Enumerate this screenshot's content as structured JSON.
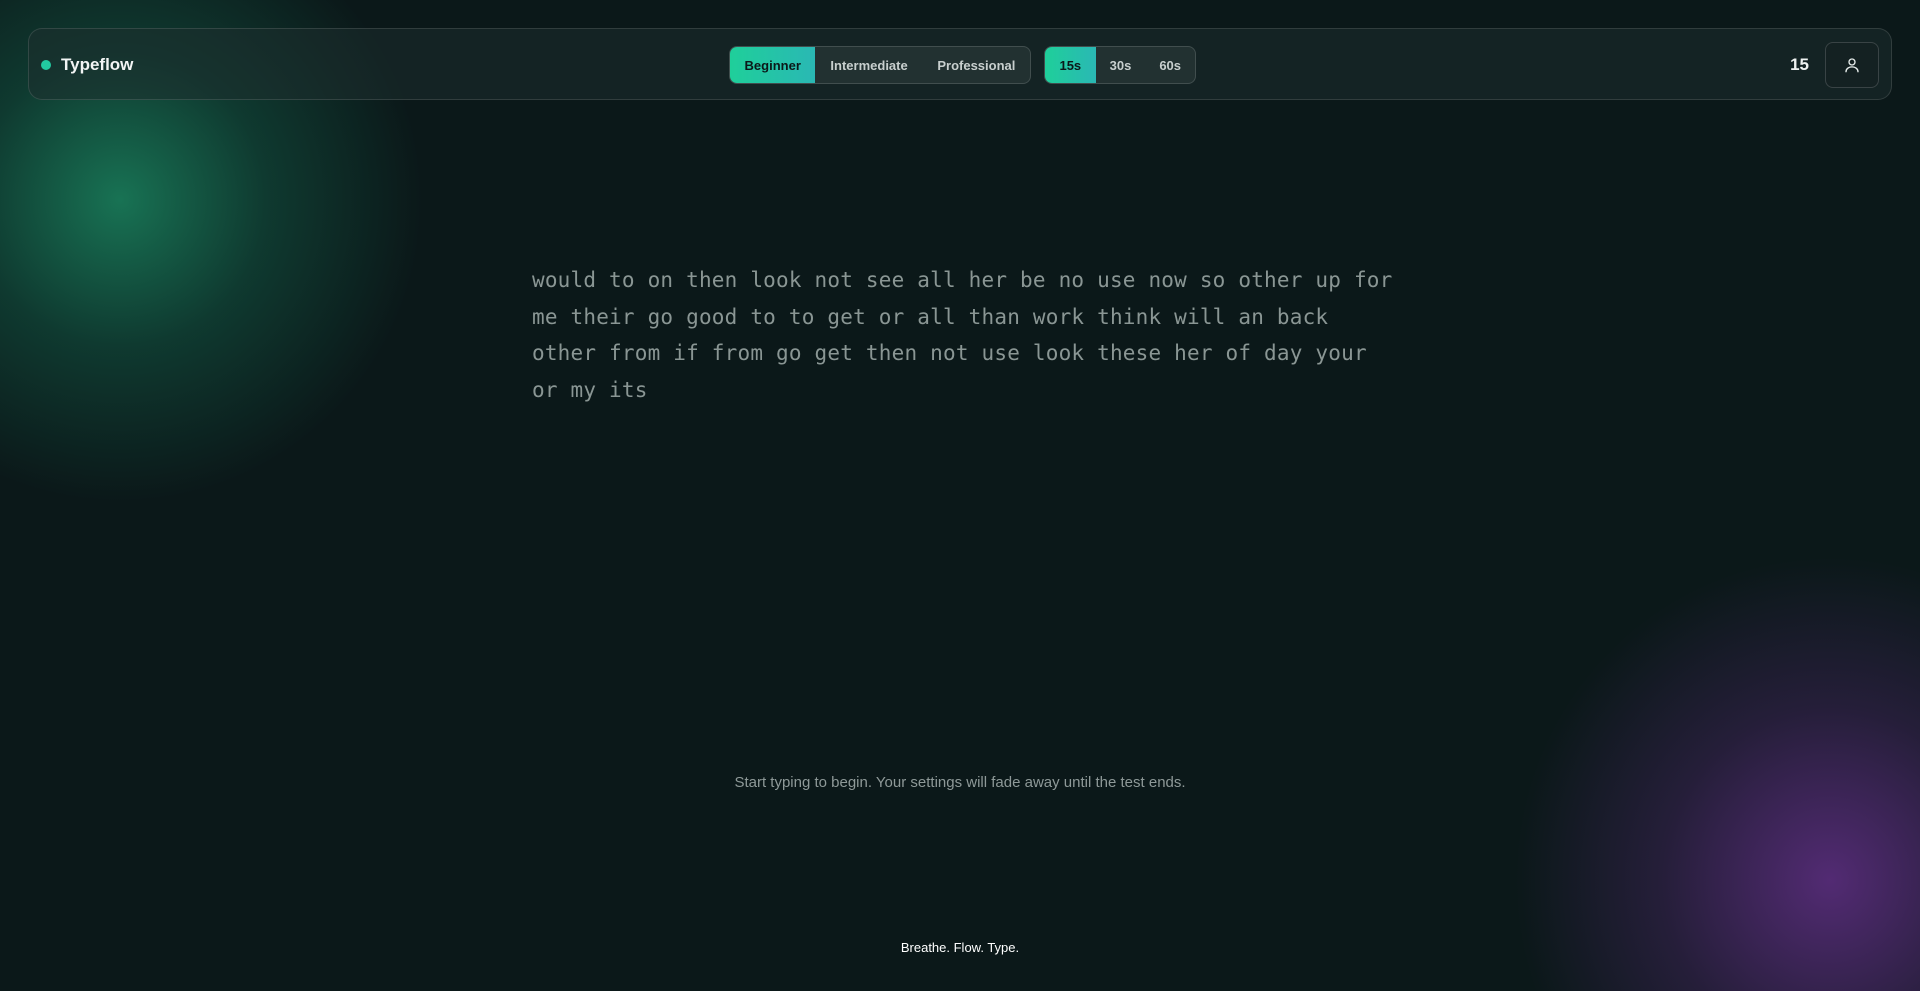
{
  "brand": {
    "name": "Typeflow",
    "accent": "#22c9a0"
  },
  "difficulty": {
    "options": [
      "Beginner",
      "Intermediate",
      "Professional"
    ],
    "selected": "Beginner"
  },
  "duration": {
    "options": [
      "15s",
      "30s",
      "60s"
    ],
    "selected": "15s"
  },
  "timer": {
    "value": "15"
  },
  "user_icon": "user-icon",
  "test_text": {
    "lines": [
      "would to on then look not see all her be no use now so other up for",
      "me their go good to to get or all than work think will an back",
      "other from if from go get then not use look these her of day your",
      "or my its"
    ]
  },
  "hint": "Start typing to begin. Your settings will fade away until the test ends.",
  "tagline": "Breathe. Flow. Type.",
  "colors": {
    "background": "#0b1819",
    "accent_start": "#1fcf9a",
    "accent_end": "#2ab8b4",
    "glow_green": "#20aa78",
    "glow_purple": "#6e3296"
  }
}
